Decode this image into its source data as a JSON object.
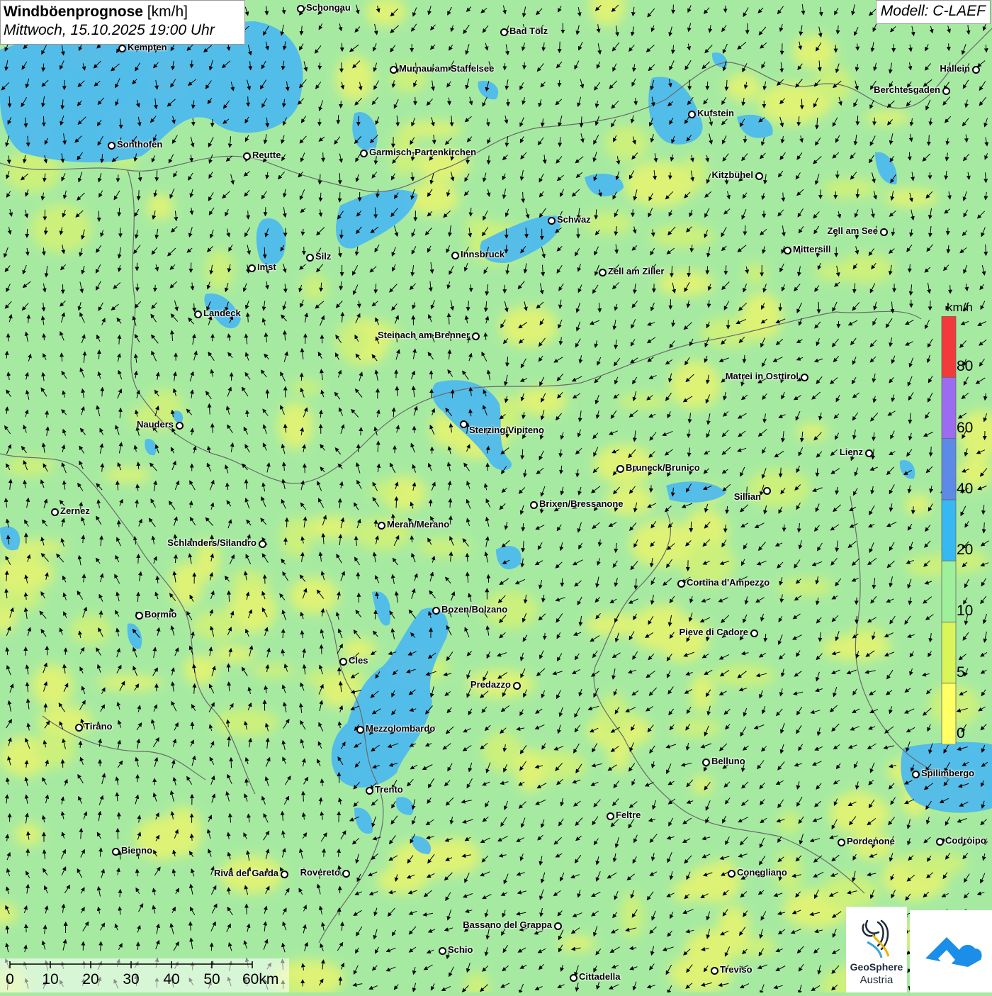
{
  "header": {
    "title_bold": "Windböenprognose",
    "title_unit": " [km/h]",
    "datetime": "Mittwoch, 15.10.2025 19:00 Uhr",
    "model": "Modell: C-LAEF"
  },
  "legend": {
    "unit": "km/h",
    "classes": [
      {
        "label": "0",
        "color": "#ffff66"
      },
      {
        "label": "5",
        "color": "#d9f55a"
      },
      {
        "label": "10",
        "color": "#9ef09a"
      },
      {
        "label": "20",
        "color": "#38b8f2"
      },
      {
        "label": "40",
        "color": "#5c8ae6"
      },
      {
        "label": "60",
        "color": "#9b6cf0"
      },
      {
        "label": "80",
        "color": "#f23a3a"
      }
    ]
  },
  "scale": {
    "labels": [
      "0",
      "10",
      "20",
      "30",
      "40",
      "50",
      "60km"
    ]
  },
  "logos": {
    "geosphere_line1": "GeoSphere",
    "geosphere_line2": "Austria"
  },
  "cities": [
    {
      "name": "Schongau"
    },
    {
      "name": "Bad Tölz"
    },
    {
      "name": "Kempten"
    },
    {
      "name": "Hallein"
    },
    {
      "name": "Murnau am Staffelsee"
    },
    {
      "name": "Berchtesgaden"
    },
    {
      "name": "Kufstein"
    },
    {
      "name": "Sonthofen"
    },
    {
      "name": "Reutte"
    },
    {
      "name": "Garmisch-Partenkirchen"
    },
    {
      "name": "Kitzbühel"
    },
    {
      "name": "Schwaz"
    },
    {
      "name": "Zell am See"
    },
    {
      "name": "Innsbruck"
    },
    {
      "name": "Silz"
    },
    {
      "name": "Mittersill"
    },
    {
      "name": "Imst"
    },
    {
      "name": "Zell am Ziller"
    },
    {
      "name": "Landeck"
    },
    {
      "name": "Steinach am Brenner"
    },
    {
      "name": "Matrei in Osttirol"
    },
    {
      "name": "Nauders"
    },
    {
      "name": "Sterzing/Vipiteno"
    },
    {
      "name": "Lienz"
    },
    {
      "name": "Bruneck/Brunico"
    },
    {
      "name": "Sillian"
    },
    {
      "name": "Brixen/Bressanone"
    },
    {
      "name": "Zernez"
    },
    {
      "name": "Meran/Merano"
    },
    {
      "name": "Schlanders/Silandro"
    },
    {
      "name": "Cortina d'Ampezzo"
    },
    {
      "name": "Bozen/Bolzano"
    },
    {
      "name": "Bormio"
    },
    {
      "name": "Pieve di Cadore"
    },
    {
      "name": "Cles"
    },
    {
      "name": "Predazzo"
    },
    {
      "name": "Tirano"
    },
    {
      "name": "Mezzolombardo"
    },
    {
      "name": "Belluno"
    },
    {
      "name": "Spilimbergo"
    },
    {
      "name": "Trento"
    },
    {
      "name": "Feltre"
    },
    {
      "name": "Pordenone"
    },
    {
      "name": "Codroipo"
    },
    {
      "name": "Bienno"
    },
    {
      "name": "Riva del Garda"
    },
    {
      "name": "Rovereto"
    },
    {
      "name": "Conegliano"
    },
    {
      "name": "Bassano del Grappa"
    },
    {
      "name": "Schio"
    },
    {
      "name": "Treviso"
    },
    {
      "name": "Cittadella"
    }
  ]
}
